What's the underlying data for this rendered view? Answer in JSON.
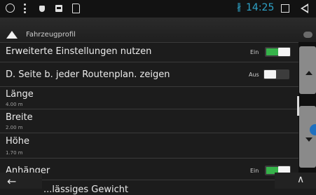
{
  "status_bar": {
    "time": "14:25",
    "icons": [
      "circle-icon",
      "kebab-menu-icon",
      "shield-icon",
      "image-icon",
      "sd-card-icon",
      "bluetooth-icon",
      "recent-apps-icon",
      "back-icon"
    ],
    "accent_color": "#2ea3c8"
  },
  "header": {
    "title": "Fahrzeugprofil"
  },
  "settings": [
    {
      "label": "Erweiterte Einstellungen nutzen",
      "state": "Ein"
    },
    {
      "label": "D. Seite b. jeder Routenplan. zeigen",
      "state": "Aus"
    },
    {
      "label": "Länge",
      "value": "4.00 m"
    },
    {
      "label": "Breite",
      "value": "2.00 m"
    },
    {
      "label": "Höhe",
      "value": "1.70 m"
    },
    {
      "label": "Anhänger",
      "state": "Ein"
    },
    {
      "label": "...lässiges Gewicht"
    }
  ],
  "colors": {
    "toggle_on": "#36b34a",
    "background": "#1c1c1c"
  }
}
